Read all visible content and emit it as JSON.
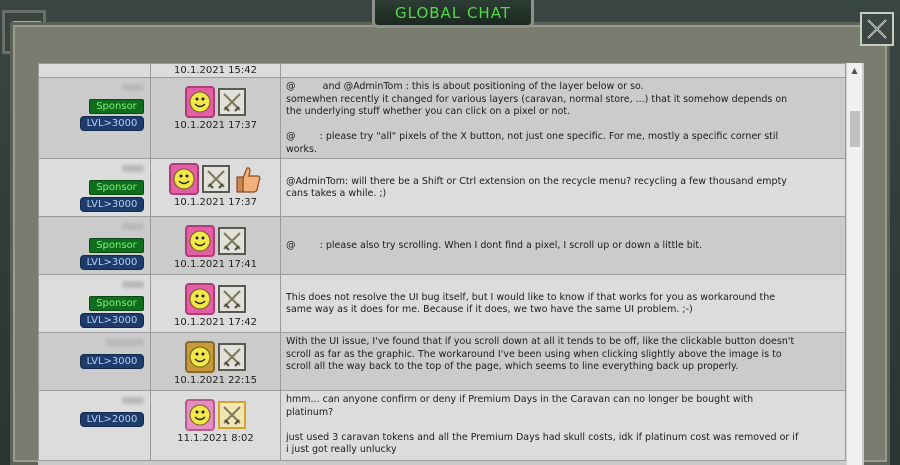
{
  "window": {
    "title": "GLOBAL CHAT"
  },
  "messages": [
    {
      "user": "",
      "badges": [],
      "timestamp": "10.1.2021 15:42",
      "lines": []
    },
    {
      "user": "",
      "sponsor": "Sponsor",
      "level": "LVL>3000",
      "timestamp": "10.1.2021 17:37",
      "lines": [
        "@         and @AdminTom : this is about positioning of the layer below or so.",
        "somewhen recently it changed for various layers (caravan, normal store, ...) that it somehow depends on",
        "the underlying stuff whether you can click on a pixel or not.",
        "",
        "@        : please try \"all\" pixels of the X button, not just one specific. For me, mostly a specific corner stil",
        "works."
      ]
    },
    {
      "user": "",
      "sponsor": "Sponsor",
      "level": "LVL>3000",
      "timestamp": "10.1.2021 17:37",
      "lines": [
        "@AdminTom: will there be a Shift or Ctrl extension on the recycle menu? recycling a few thousand empty",
        "cans takes a while. ;)"
      ]
    },
    {
      "user": "",
      "sponsor": "Sponsor",
      "level": "LVL>3000",
      "timestamp": "10.1.2021 17:41",
      "lines": [
        "@        : please also try scrolling. When I dont find a pixel, I scroll up or down a little bit."
      ]
    },
    {
      "user": "",
      "sponsor": "Sponsor",
      "level": "LVL>3000",
      "timestamp": "10.1.2021 17:42",
      "lines": [
        "This does not resolve the UI bug itself, but I would like to know if that works for you as workaround the",
        "same way as it does for me. Because if it does, we two have the same UI problem. ;-)"
      ]
    },
    {
      "user": "",
      "level": "LVL>3000",
      "timestamp": "10.1.2021 22:15",
      "lines": [
        "With the UI issue, I've found that if you scroll down at all it tends to be off, like the clickable button doesn't",
        "scroll as far as the graphic. The workaround I've been using when clicking slightly above the image is to",
        "scroll all the way back to the top of the page, which seems to line everything back up properly."
      ]
    },
    {
      "user": "",
      "level": "LVL>2000",
      "timestamp": "11.1.2021 8:02",
      "lines": [
        "hmm... can anyone confirm or deny if Premium Days in the Caravan can no longer be bought with",
        "platinum?",
        "",
        "just used 3 caravan tokens and all the Premium Days had skull costs, idk if platinum cost was removed or if",
        "i just got really unlucky"
      ]
    }
  ],
  "icons": {
    "close": "close-icon",
    "avatar": "smiley-avatar-icon",
    "swords": "crossed-swords-icon",
    "thumb": "thumbs-up-icon"
  },
  "colors": {
    "title_text": "#4fdc45",
    "sponsor_bg": "#0f6d1d",
    "sponsor_text": "#7cf571",
    "level_bg": "#1e3c6b",
    "level_text": "#b6cff2"
  }
}
